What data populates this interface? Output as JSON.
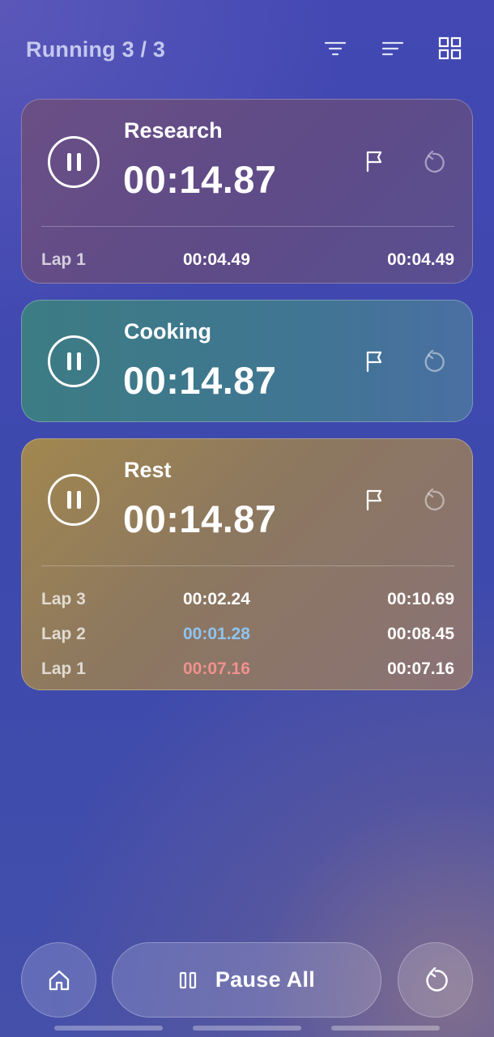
{
  "header": {
    "title": "Running 3 / 3",
    "icons": [
      "filter-icon",
      "sort-icon",
      "grid-view-icon"
    ]
  },
  "timers": [
    {
      "name": "Research",
      "time": "00:14.87",
      "color": "#6b4f86",
      "laps": [
        {
          "label": "Lap 1",
          "split": "00:04.49",
          "total": "00:04.49",
          "split_color": "#ffffff"
        }
      ]
    },
    {
      "name": "Cooking",
      "time": "00:14.87",
      "color": "#3f7a8c",
      "laps": []
    },
    {
      "name": "Rest",
      "time": "00:14.87",
      "color": "#a1874f",
      "laps": [
        {
          "label": "Lap 3",
          "split": "00:02.24",
          "total": "00:10.69",
          "split_color": "#ffffff"
        },
        {
          "label": "Lap 2",
          "split": "00:01.28",
          "total": "00:08.45",
          "split_color": "#8fc3ef"
        },
        {
          "label": "Lap 1",
          "split": "00:07.16",
          "total": "00:07.16",
          "split_color": "#f0918e"
        }
      ]
    }
  ],
  "bottom": {
    "home_icon": "home-icon",
    "pause_all_label": "Pause All",
    "pause_all_icon": "pause-outline-icon",
    "reset_all_icon": "reset-icon"
  },
  "colors": {
    "background": "#4048b0",
    "fastest_lap": "#8fc3ef",
    "slowest_lap": "#f0918e",
    "header_text": "#c4c8ee"
  }
}
